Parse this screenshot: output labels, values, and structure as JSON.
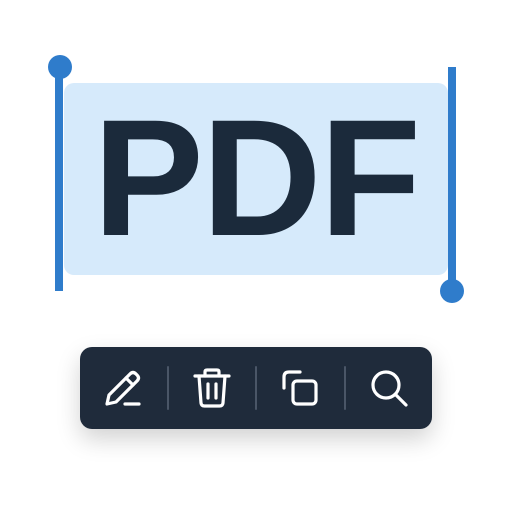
{
  "selection": {
    "text": "PDF",
    "highlight_color": "#d6eafb",
    "handle_color": "#2f7ccb",
    "text_color": "#1b2a3b"
  },
  "toolbar": {
    "background_color": "#1f2b3b",
    "icon_color": "#ffffff",
    "items": [
      {
        "name": "edit",
        "icon": "pencil-icon"
      },
      {
        "name": "delete",
        "icon": "trash-icon"
      },
      {
        "name": "copy",
        "icon": "copy-icon"
      },
      {
        "name": "search",
        "icon": "search-icon"
      }
    ]
  }
}
